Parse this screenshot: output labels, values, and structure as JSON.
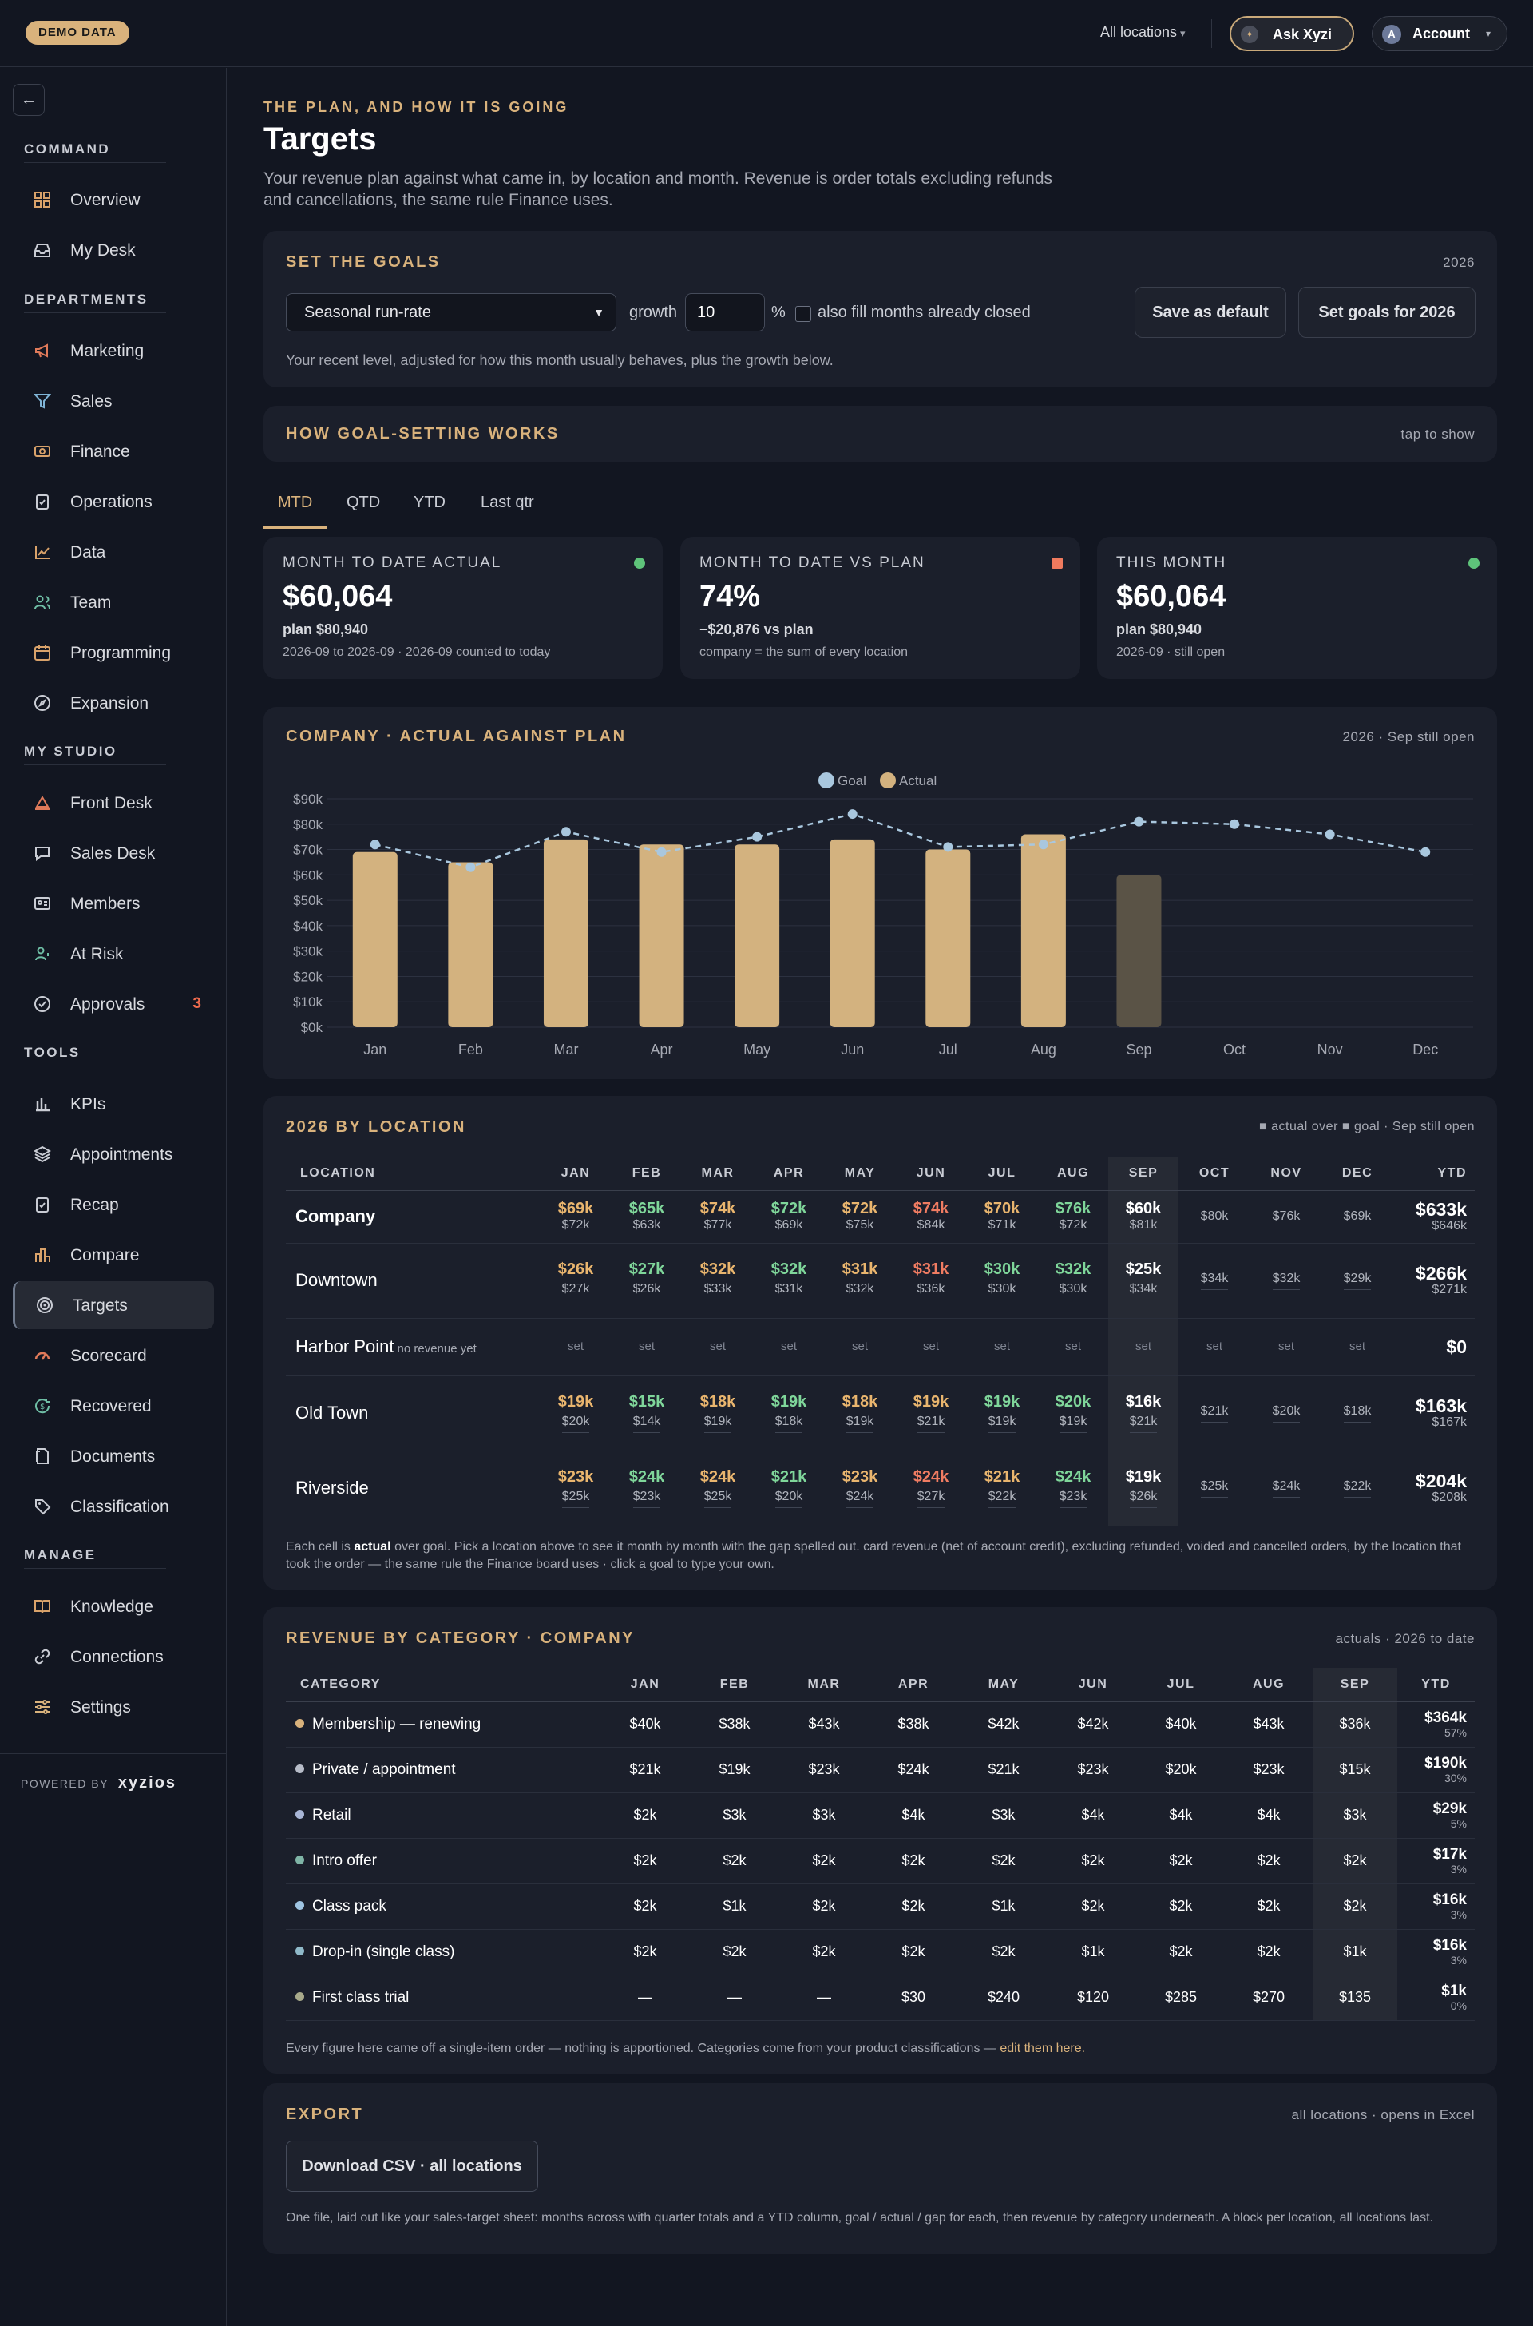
{
  "topbar": {
    "demo_badge": "DEMO DATA",
    "location_select": "All locations",
    "ask_label": "Ask Xyzi",
    "account_label": "Account",
    "account_initial": "A"
  },
  "sidebar": {
    "sections": {
      "command": "COMMAND",
      "departments": "DEPARTMENTS",
      "my_studio": "MY STUDIO",
      "tools": "TOOLS",
      "manage": "MANAGE"
    },
    "items": {
      "overview": "Overview",
      "my_desk": "My Desk",
      "marketing": "Marketing",
      "sales": "Sales",
      "finance": "Finance",
      "operations": "Operations",
      "data": "Data",
      "team": "Team",
      "programming": "Programming",
      "expansion": "Expansion",
      "front_desk": "Front Desk",
      "sales_desk": "Sales Desk",
      "members": "Members",
      "at_risk": "At Risk",
      "approvals": "Approvals",
      "approvals_badge": "3",
      "kpis": "KPIs",
      "appointments": "Appointments",
      "recap": "Recap",
      "compare": "Compare",
      "targets": "Targets",
      "scorecard": "Scorecard",
      "recovered": "Recovered",
      "documents": "Documents",
      "classification": "Classification",
      "knowledge": "Knowledge",
      "connections": "Connections",
      "settings": "Settings"
    },
    "powered_by": "POWERED BY",
    "brand": "xyzios"
  },
  "header": {
    "eyebrow": "THE PLAN, AND HOW IT IS GOING",
    "title": "Targets",
    "description": "Your revenue plan against what came in, by location and month. Revenue is order totals excluding refunds and cancellations, the same rule Finance uses."
  },
  "goals": {
    "title": "SET THE GOALS",
    "year": "2026",
    "method": "Seasonal run-rate",
    "growth_label": "growth",
    "growth_value": "10",
    "pct": "%",
    "fill_closed_label": "also fill months already closed",
    "save_default": "Save as default",
    "set_goals": "Set goals for 2026",
    "help": "Your recent level, adjusted for how this month usually behaves, plus the growth below."
  },
  "how": {
    "title": "HOW GOAL-SETTING WORKS",
    "toggle": "tap to show"
  },
  "period_tabs": [
    "MTD",
    "QTD",
    "YTD",
    "Last qtr"
  ],
  "kpis": [
    {
      "label": "MONTH TO DATE ACTUAL",
      "value": "$60,064",
      "sub": "plan $80,940",
      "note": "2026-09 to 2026-09 · 2026-09 counted to today",
      "status_color": "#5ec37a"
    },
    {
      "label": "MONTH TO DATE VS PLAN",
      "value": "74%",
      "sub": "−$20,876 vs plan",
      "note": "company = the sum of every location",
      "status_color": "#ef7a5e"
    },
    {
      "label": "THIS MONTH",
      "value": "$60,064",
      "sub": "plan $80,940",
      "note": "2026-09 · still open",
      "status_color": "#5ec37a"
    }
  ],
  "chart_card": {
    "title": "COMPANY · ACTUAL AGAINST PLAN",
    "meta": "2026 · Sep still open"
  },
  "chart_data": {
    "type": "bar",
    "categories": [
      "Jan",
      "Feb",
      "Mar",
      "Apr",
      "May",
      "Jun",
      "Jul",
      "Aug",
      "Sep",
      "Oct",
      "Nov",
      "Dec"
    ],
    "series": [
      {
        "name": "Actual",
        "type": "bar",
        "values": [
          69,
          65,
          74,
          72,
          72,
          74,
          70,
          76,
          60,
          null,
          null,
          null
        ]
      },
      {
        "name": "Goal",
        "type": "line",
        "values": [
          72,
          63,
          77,
          69,
          75,
          84,
          71,
          72,
          81,
          80,
          76,
          69
        ]
      }
    ],
    "ylim": [
      0,
      90
    ],
    "yticks": [
      "$0k",
      "$10k",
      "$20k",
      "$30k",
      "$40k",
      "$50k",
      "$60k",
      "$70k",
      "$80k",
      "$90k"
    ],
    "legend": [
      "Goal",
      "Actual"
    ],
    "colors": {
      "actual": "#d3b27f",
      "open_month": "#5a5346",
      "goal": "#a9c7de"
    },
    "grid": true,
    "legend_position": "top-center"
  },
  "locations": {
    "title": "2026 BY LOCATION",
    "meta": "■ actual over ■ goal · Sep still open",
    "headers": [
      "LOCATION",
      "JAN",
      "FEB",
      "MAR",
      "APR",
      "MAY",
      "JUN",
      "JUL",
      "AUG",
      "SEP",
      "OCT",
      "NOV",
      "DEC",
      "YTD"
    ],
    "rows": [
      {
        "name": "Company",
        "note": "",
        "cells": [
          [
            "$69k",
            "$72k"
          ],
          [
            "$65k",
            "$63k"
          ],
          [
            "$74k",
            "$77k"
          ],
          [
            "$72k",
            "$69k"
          ],
          [
            "$72k",
            "$75k"
          ],
          [
            "$74k",
            "$84k"
          ],
          [
            "$70k",
            "$71k"
          ],
          [
            "$76k",
            "$72k"
          ],
          [
            "$60k",
            "$81k"
          ],
          [
            "",
            "$80k"
          ],
          [
            "",
            "$76k"
          ],
          [
            "",
            "$69k"
          ]
        ],
        "ytd": [
          "$633k",
          "$646k"
        ]
      },
      {
        "name": "Downtown",
        "note": "",
        "cells": [
          [
            "$26k",
            "$27k"
          ],
          [
            "$27k",
            "$26k"
          ],
          [
            "$32k",
            "$33k"
          ],
          [
            "$32k",
            "$31k"
          ],
          [
            "$31k",
            "$32k"
          ],
          [
            "$31k",
            "$36k"
          ],
          [
            "$30k",
            "$30k"
          ],
          [
            "$32k",
            "$30k"
          ],
          [
            "$25k",
            "$34k"
          ],
          [
            "",
            "$34k"
          ],
          [
            "",
            "$32k"
          ],
          [
            "",
            "$29k"
          ]
        ],
        "ytd": [
          "$266k",
          "$271k"
        ]
      },
      {
        "name": "Harbor Point",
        "note": "no revenue yet",
        "cells": [
          [
            "",
            "set"
          ],
          [
            "",
            "set"
          ],
          [
            "",
            "set"
          ],
          [
            "",
            "set"
          ],
          [
            "",
            "set"
          ],
          [
            "",
            "set"
          ],
          [
            "",
            "set"
          ],
          [
            "",
            "set"
          ],
          [
            "",
            "set"
          ],
          [
            "",
            "set"
          ],
          [
            "",
            "set"
          ],
          [
            "",
            "set"
          ]
        ],
        "ytd": [
          "$0",
          ""
        ]
      },
      {
        "name": "Old Town",
        "note": "",
        "cells": [
          [
            "$19k",
            "$20k"
          ],
          [
            "$15k",
            "$14k"
          ],
          [
            "$18k",
            "$19k"
          ],
          [
            "$19k",
            "$18k"
          ],
          [
            "$18k",
            "$19k"
          ],
          [
            "$19k",
            "$21k"
          ],
          [
            "$19k",
            "$19k"
          ],
          [
            "$20k",
            "$19k"
          ],
          [
            "$16k",
            "$21k"
          ],
          [
            "",
            "$21k"
          ],
          [
            "",
            "$20k"
          ],
          [
            "",
            "$18k"
          ]
        ],
        "ytd": [
          "$163k",
          "$167k"
        ]
      },
      {
        "name": "Riverside",
        "note": "",
        "cells": [
          [
            "$23k",
            "$25k"
          ],
          [
            "$24k",
            "$23k"
          ],
          [
            "$24k",
            "$25k"
          ],
          [
            "$21k",
            "$20k"
          ],
          [
            "$23k",
            "$24k"
          ],
          [
            "$24k",
            "$27k"
          ],
          [
            "$21k",
            "$22k"
          ],
          [
            "$24k",
            "$23k"
          ],
          [
            "$19k",
            "$26k"
          ],
          [
            "",
            "$25k"
          ],
          [
            "",
            "$24k"
          ],
          [
            "",
            "$22k"
          ]
        ],
        "ytd": [
          "$204k",
          "$208k"
        ]
      }
    ],
    "note_pre": "Each cell is ",
    "note_bold": "actual",
    "note_post": " over goal. Pick a location above to see it month by month with the gap spelled out. card revenue (net of account credit), excluding refunded, voided and cancelled orders, by the location that took the order — the same rule the Finance board uses · click a goal to type your own."
  },
  "categories": {
    "title": "REVENUE BY CATEGORY · COMPANY",
    "meta": "actuals · 2026 to date",
    "headers": [
      "CATEGORY",
      "JAN",
      "FEB",
      "MAR",
      "APR",
      "MAY",
      "JUN",
      "JUL",
      "AUG",
      "SEP",
      "YTD"
    ],
    "rows": [
      {
        "name": "Membership — renewing",
        "color": "#d9b27c",
        "values": [
          "$40k",
          "$38k",
          "$43k",
          "$38k",
          "$42k",
          "$42k",
          "$40k",
          "$43k",
          "$36k"
        ],
        "ytd": "$364k",
        "pct": "57%"
      },
      {
        "name": "Private / appointment",
        "color": "#b7bcc8",
        "values": [
          "$21k",
          "$19k",
          "$23k",
          "$24k",
          "$21k",
          "$23k",
          "$20k",
          "$23k",
          "$15k"
        ],
        "ytd": "$190k",
        "pct": "30%"
      },
      {
        "name": "Retail",
        "color": "#a9b6d6",
        "values": [
          "$2k",
          "$3k",
          "$3k",
          "$4k",
          "$3k",
          "$4k",
          "$4k",
          "$4k",
          "$3k"
        ],
        "ytd": "$29k",
        "pct": "5%"
      },
      {
        "name": "Intro offer",
        "color": "#7fb4a6",
        "values": [
          "$2k",
          "$2k",
          "$2k",
          "$2k",
          "$2k",
          "$2k",
          "$2k",
          "$2k",
          "$2k"
        ],
        "ytd": "$17k",
        "pct": "3%"
      },
      {
        "name": "Class pack",
        "color": "#9fc4e2",
        "values": [
          "$2k",
          "$1k",
          "$2k",
          "$2k",
          "$1k",
          "$2k",
          "$2k",
          "$2k",
          "$2k"
        ],
        "ytd": "$16k",
        "pct": "3%"
      },
      {
        "name": "Drop-in (single class)",
        "color": "#8fb9c9",
        "values": [
          "$2k",
          "$2k",
          "$2k",
          "$2k",
          "$2k",
          "$1k",
          "$2k",
          "$2k",
          "$1k"
        ],
        "ytd": "$16k",
        "pct": "3%"
      },
      {
        "name": "First class trial",
        "color": "#a8a98a",
        "values": [
          "—",
          "—",
          "—",
          "$30",
          "$240",
          "$120",
          "$285",
          "$270",
          "$135"
        ],
        "ytd": "$1k",
        "pct": "0%"
      }
    ],
    "note": "Every figure here came off a single-item order — nothing is apportioned. Categories come from your product classifications — ",
    "note_link": "edit them here."
  },
  "export": {
    "title": "EXPORT",
    "meta": "all locations · opens in Excel",
    "button": "Download CSV · all locations",
    "note": "One file, laid out like your sales-target sheet: months across with quarter totals and a YTD column, goal / actual / gap for each, then revenue by category underneath. A block per location, all locations last."
  }
}
